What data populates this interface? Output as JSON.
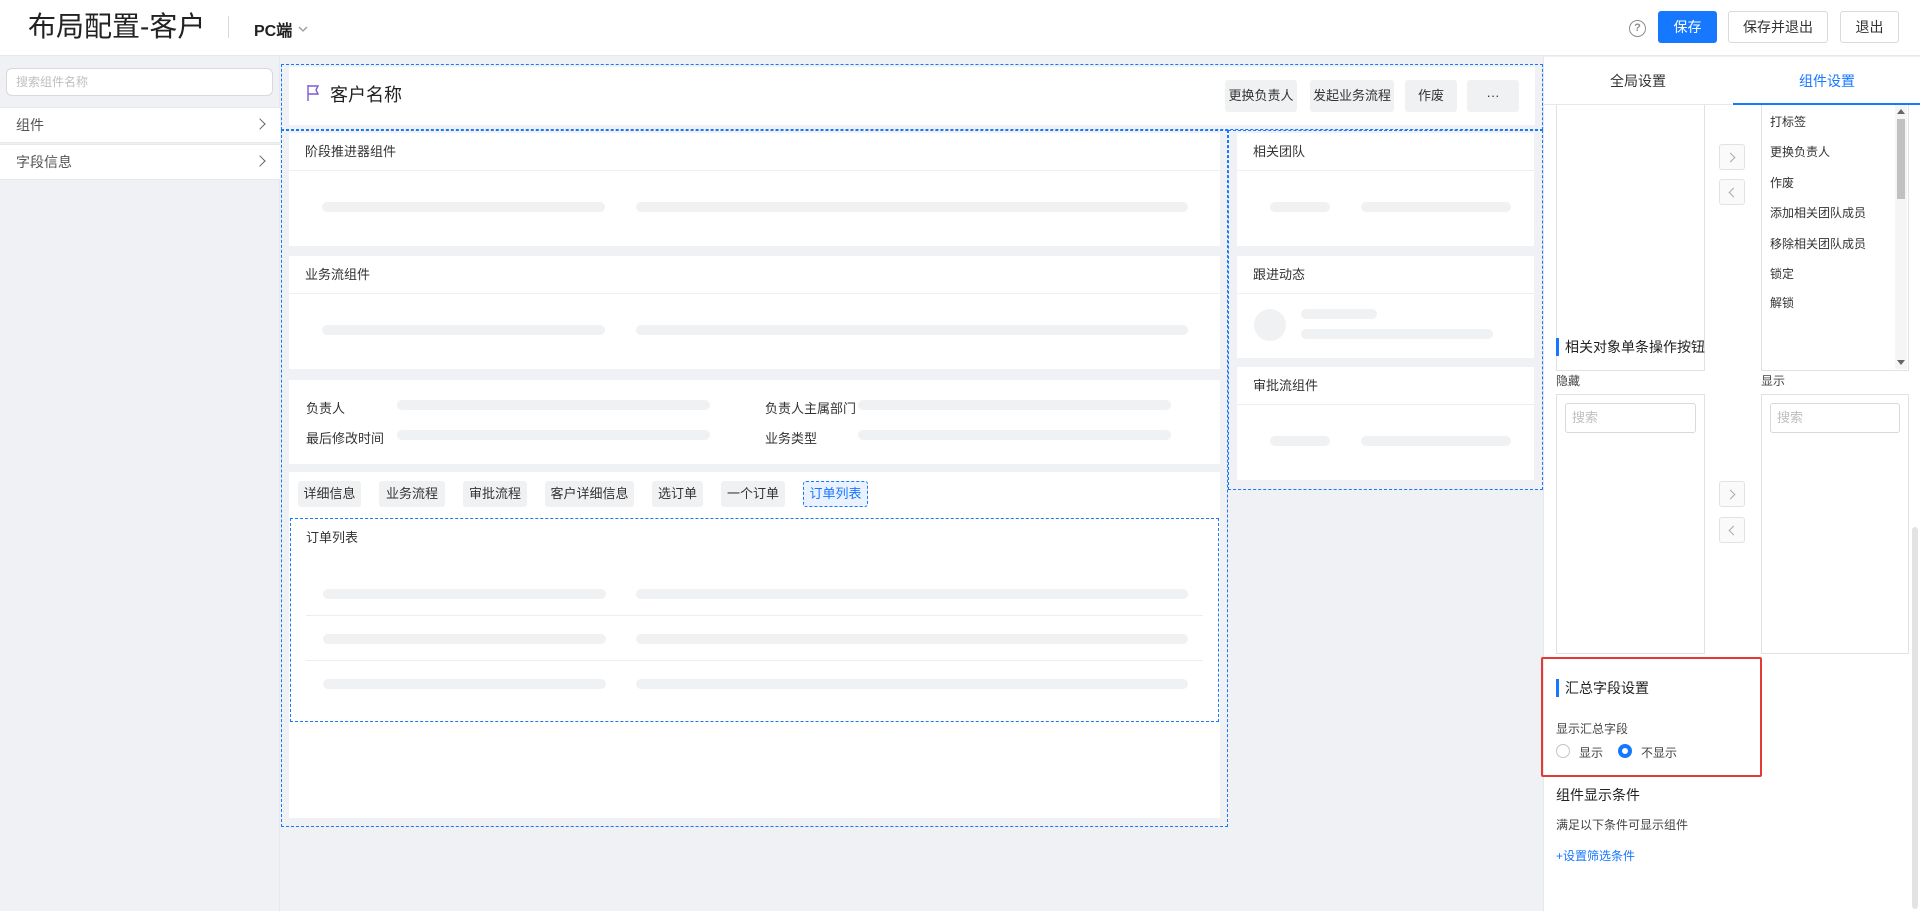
{
  "header": {
    "title": "布局配置-客户",
    "platform": "PC端",
    "help_icon": "?",
    "save_label": "保存",
    "save_exit_label": "保存并退出",
    "exit_label": "退出",
    "accent_color": "#1677ff"
  },
  "sidebar": {
    "search_placeholder": "搜索组件名称",
    "groups": [
      {
        "label": "组件"
      },
      {
        "label": "字段信息"
      }
    ]
  },
  "canvas": {
    "record_title": "客户名称",
    "actions": [
      "更换负责人",
      "发起业务流程",
      "作废",
      "···"
    ],
    "left_cards": {
      "stage": "阶段推进器组件",
      "business_flow": "业务流组件"
    },
    "fields": {
      "owner": "负责人",
      "owner_dept": "负责人主属部门",
      "last_modified": "最后修改时间",
      "business_type": "业务类型"
    },
    "tabs": [
      "详细信息",
      "业务流程",
      "审批流程",
      "客户详细信息",
      "选订单",
      "一个订单",
      "订单列表"
    ],
    "active_tab": "订单列表",
    "order_list_title": "订单列表",
    "right_cards": {
      "team": "相关团队",
      "follow": "跟进动态",
      "approval": "审批流组件"
    }
  },
  "panel": {
    "tabs": [
      "全局设置",
      "组件设置"
    ],
    "active_tab": "组件设置",
    "top_shown_list": [
      "打标签",
      "更换负责人",
      "作废",
      "添加相关团队成员",
      "移除相关团队成员",
      "锁定",
      "解锁"
    ],
    "related_section": {
      "title": "相关对象单条操作按钮",
      "hidden_label": "隐藏",
      "shown_label": "显示",
      "search_placeholder": "搜索"
    },
    "summary_section": {
      "title": "汇总字段设置",
      "field_label": "显示汇总字段",
      "option_show": "显示",
      "option_hide": "不显示",
      "selected": "不显示"
    },
    "condition_section": {
      "title": "组件显示条件",
      "desc": "满足以下条件可显示组件",
      "link": "+设置筛选条件"
    }
  }
}
